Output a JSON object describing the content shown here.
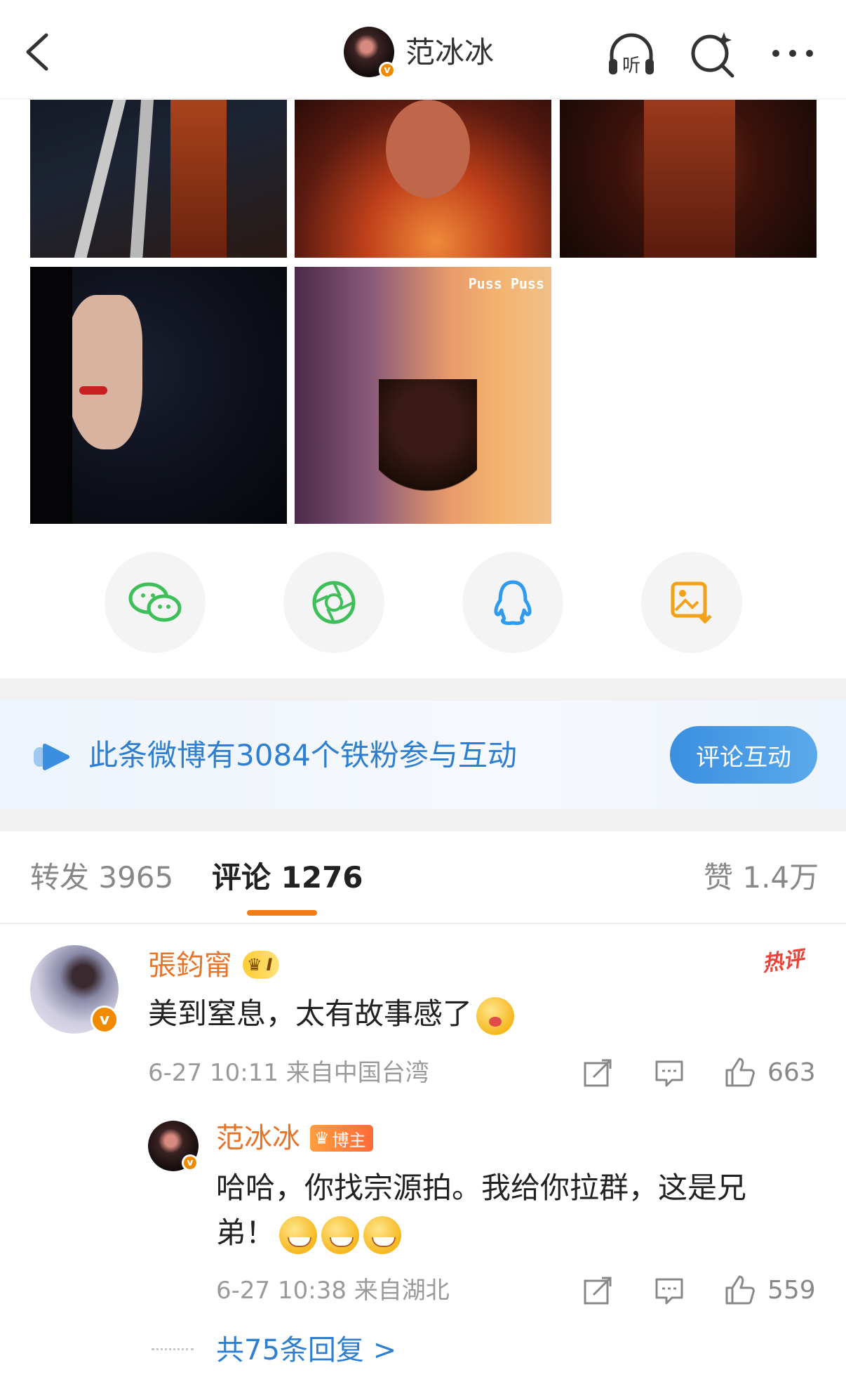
{
  "header": {
    "back_icon": "chevron-left-icon",
    "user_name": "范冰冰",
    "verified_mark": "v",
    "listen_label": "听",
    "icons": [
      "headphones-listen-icon",
      "search-sparkle-icon",
      "more-dots-icon"
    ]
  },
  "gallery": {
    "images": [
      {
        "desc": "woman-on-ladder-red-dress"
      },
      {
        "desc": "woman-face-warm-light"
      },
      {
        "desc": "woman-red-silk-dress"
      },
      {
        "desc": "woman-smoking-dark-profile"
      },
      {
        "desc": "woman-arm-raised-orange-wall"
      }
    ],
    "image5_text": "Puss Puss"
  },
  "share": {
    "buttons": [
      {
        "icon": "wechat-icon",
        "color": "#3fbf5a"
      },
      {
        "icon": "moments-icon",
        "color": "#3fbf5a"
      },
      {
        "icon": "qq-icon",
        "color": "#2f9bf0"
      },
      {
        "icon": "save-image-icon",
        "color": "#f2a218"
      }
    ]
  },
  "banner": {
    "text": "此条微博有3084个铁粉参与互动",
    "button": "评论互动"
  },
  "tabs": {
    "repost": "转发 3965",
    "comment": "评论 1276",
    "like": "赞 1.4万"
  },
  "comments": [
    {
      "user": "張鈞甯",
      "level": "I",
      "hot_tag": "热评",
      "text": "美到窒息，太有故事感了",
      "time_source": "6-27 10:11  来自中国台湾",
      "likes": "663",
      "verified_mark": "v"
    },
    {
      "user": "范冰冰",
      "badge": "博主",
      "text": "哈哈，你找宗源拍。我给你拉群，这是兄弟！",
      "time_source": "6-27 10:38  来自湖北",
      "likes": "559",
      "verified_mark": "v"
    }
  ],
  "more_replies": "共75条回复 >",
  "colors": {
    "accent_orange": "#f07c13",
    "link_blue": "#2f7fd1",
    "username_orange": "#e8742a"
  }
}
